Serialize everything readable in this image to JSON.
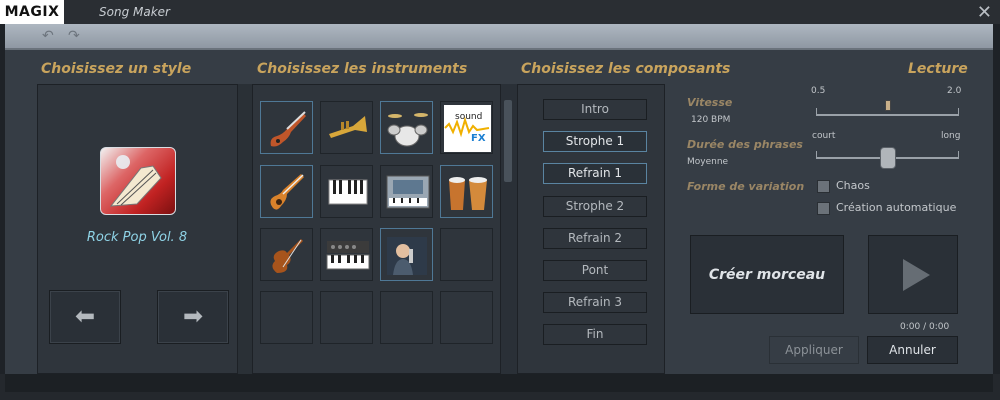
{
  "window": {
    "logo": "MAGIX",
    "title": "Song Maker"
  },
  "sections": {
    "style": "Choisissez un style",
    "instruments": "Choisissez les instruments",
    "components": "Choisissez les composants",
    "playback": "Lecture"
  },
  "style_panel": {
    "style_name": "Rock Pop Vol. 8",
    "prev_icon": "arrow-left-icon",
    "next_icon": "arrow-right-icon"
  },
  "instruments": [
    {
      "name": "electric-guitar",
      "selected": true
    },
    {
      "name": "trumpet",
      "selected": false
    },
    {
      "name": "drum-kit",
      "selected": true
    },
    {
      "name": "sound-fx",
      "selected": false,
      "label_top": "sound",
      "label_bottom": "FX"
    },
    {
      "name": "acoustic-guitar",
      "selected": true
    },
    {
      "name": "keyboard",
      "selected": false
    },
    {
      "name": "synth-workstation",
      "selected": false
    },
    {
      "name": "bongos",
      "selected": true
    },
    {
      "name": "violin",
      "selected": false
    },
    {
      "name": "piano-synth",
      "selected": false
    },
    {
      "name": "vocalist",
      "selected": true
    },
    {
      "name": "empty",
      "selected": false
    }
  ],
  "components": [
    {
      "label": "Intro",
      "active": false
    },
    {
      "label": "Strophe 1",
      "active": true
    },
    {
      "label": "Refrain 1",
      "active": true
    },
    {
      "label": "Strophe 2",
      "active": false
    },
    {
      "label": "Refrain 2",
      "active": false
    },
    {
      "label": "Pont",
      "active": false
    },
    {
      "label": "Refrain 3",
      "active": false
    },
    {
      "label": "Fin",
      "active": false
    }
  ],
  "playback": {
    "tempo_label": "Vitesse",
    "tempo_value": "120 BPM",
    "tempo_min": "0.5",
    "tempo_max": "2.0",
    "tempo_position": 0.5,
    "phrase_label": "Durée des phrases",
    "phrase_value": "Moyenne",
    "phrase_min": "court",
    "phrase_max": "long",
    "phrase_position": 0.5,
    "variation_label": "Forme de variation",
    "chaos_label": "Chaos",
    "auto_label": "Création automatique",
    "create_button": "Créer morceau",
    "time": "0:00 / 0:00",
    "apply_button": "Appliquer",
    "cancel_button": "Annuler"
  }
}
